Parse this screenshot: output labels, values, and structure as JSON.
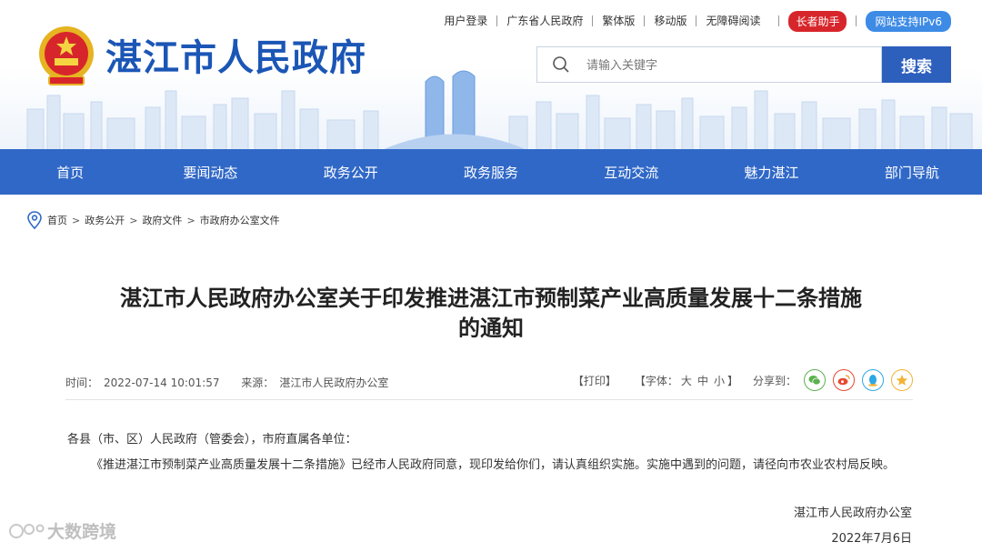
{
  "header": {
    "site_title": "湛江市人民政府",
    "top_links": [
      "用户登录",
      "广东省人民政府",
      "繁体版",
      "移动版",
      "无障碍阅读"
    ],
    "elder_helper": "长者助手",
    "ipv6_badge": "网站支持IPv6",
    "search": {
      "placeholder": "请输入关键字",
      "button_label": "搜索"
    }
  },
  "nav": {
    "items": [
      "首页",
      "要闻动态",
      "政务公开",
      "政务服务",
      "互动交流",
      "魅力湛江",
      "部门导航"
    ]
  },
  "breadcrumb": [
    "首页",
    "政务公开",
    "政府文件",
    "市政府办公室文件"
  ],
  "article": {
    "title_line1": "湛江市人民政府办公室关于印发推进湛江市预制菜产业高质量发展十二条措施",
    "title_line2": "的通知",
    "time_label": "时间：",
    "time_value": "2022-07-14 10:01:57",
    "source_label": "来源：",
    "source_value": "湛江市人民政府办公室",
    "print_label": "【打印】",
    "font_size_label": "【字体：",
    "font_sizes": [
      "大",
      "中",
      "小"
    ],
    "font_size_close": "】",
    "share_label": "分享到：",
    "salutation": "各县（市、区）人民政府（管委会），市府直属各单位：",
    "paragraph": "《推进湛江市预制菜产业高质量发展十二条措施》已经市人民政府同意，现印发给你们，请认真组织实施。实施中遇到的问题，请径向市农业农村局反映。",
    "signature": "湛江市人民政府办公室",
    "date": "2022年7月6日"
  },
  "share_icons": [
    {
      "name": "wechat-icon",
      "color": "#5bb14f"
    },
    {
      "name": "weibo-icon",
      "color": "#e6492e"
    },
    {
      "name": "qq-icon",
      "color": "#2ba8e4"
    },
    {
      "name": "qzone-icon",
      "color": "#f2b233"
    }
  ],
  "watermark": "大数跨境",
  "colors": {
    "brand_blue": "#1b56b6",
    "nav_blue": "#3068c7",
    "search_button": "#2d5fbd",
    "elder_red": "#d7262b",
    "ipv6_blue": "#3d8be5"
  }
}
